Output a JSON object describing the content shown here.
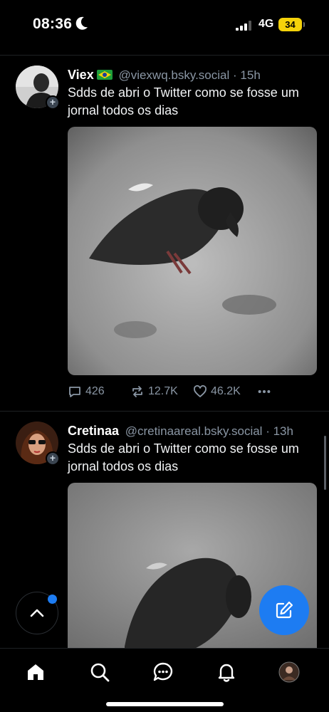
{
  "status_bar": {
    "time": "08:36",
    "network": "4G",
    "battery": "34",
    "battery_color": "#f5d20a"
  },
  "feed": {
    "posts": [
      {
        "display_name": "Viex",
        "flag_icon": "brazil-flag-icon",
        "handle": "@viexwq.bsky.social",
        "separator": "·",
        "time": "15h",
        "text": "Sdds de abri o Twitter como se fosse um jornal todos os dias",
        "replies": "426",
        "reposts": "12.7K",
        "likes": "46.2K"
      },
      {
        "display_name": "Cretinaa",
        "handle": "@cretinaareal.bsky.social",
        "separator": "·",
        "time": "13h",
        "text": "Sdds de abri o Twitter como se fosse um jornal todos os dias"
      }
    ]
  },
  "tabs": [
    "home-icon",
    "search-icon",
    "chat-icon",
    "bell-icon",
    "profile-avatar"
  ],
  "colors": {
    "accent": "#1d7cf2",
    "muted_text": "#8a96a4",
    "background": "#000000"
  }
}
